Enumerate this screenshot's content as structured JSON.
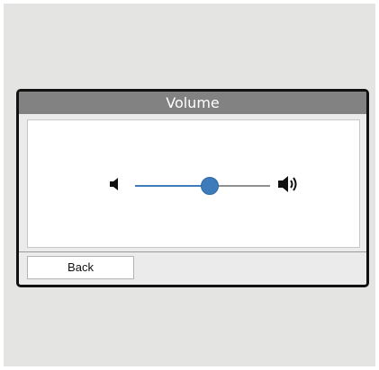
{
  "dialog": {
    "title": "Volume"
  },
  "volume": {
    "level": 0.55,
    "min_icon": "volume-low-icon",
    "max_icon": "volume-high-icon"
  },
  "footer": {
    "back_label": "Back"
  },
  "colors": {
    "accent": "#3d7bbb",
    "title_bar": "#828282",
    "track": "#8f8f8f",
    "background": "#e4e4e2"
  }
}
